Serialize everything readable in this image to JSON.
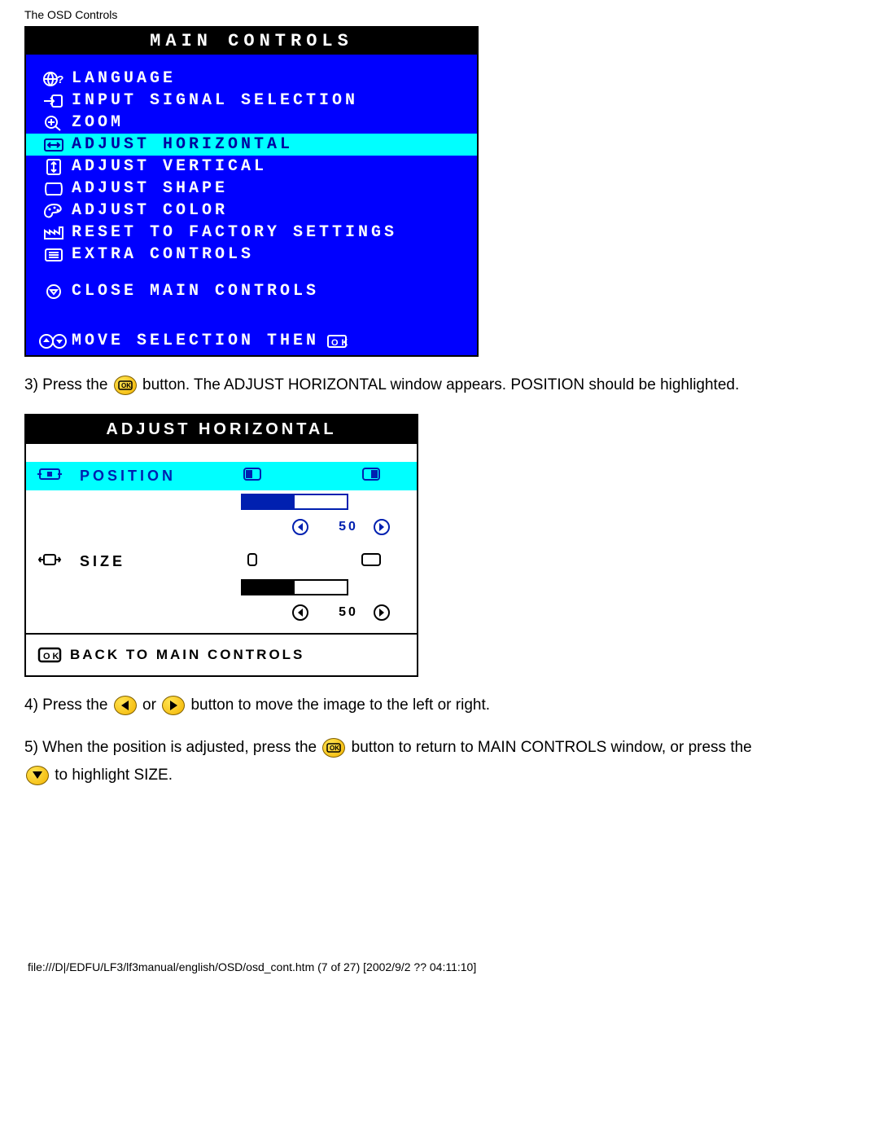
{
  "header": "The OSD Controls",
  "mainControls": {
    "title": "MAIN CONTROLS",
    "items": [
      {
        "label": "LANGUAGE",
        "highlighted": false
      },
      {
        "label": "INPUT SIGNAL SELECTION",
        "highlighted": false
      },
      {
        "label": "ZOOM",
        "highlighted": false
      },
      {
        "label": "ADJUST HORIZONTAL",
        "highlighted": true
      },
      {
        "label": "ADJUST VERTICAL",
        "highlighted": false
      },
      {
        "label": "ADJUST SHAPE",
        "highlighted": false
      },
      {
        "label": "ADJUST COLOR",
        "highlighted": false
      },
      {
        "label": "RESET TO FACTORY SETTINGS",
        "highlighted": false
      },
      {
        "label": "EXTRA CONTROLS",
        "highlighted": false
      }
    ],
    "close": "CLOSE MAIN CONTROLS",
    "footer": "MOVE SELECTION THEN"
  },
  "step3": {
    "a": "3) Press the ",
    "b": " button. The ADJUST HORIZONTAL window appears. POSITION should be highlighted."
  },
  "adjustHorizontal": {
    "title": "ADJUST HORIZONTAL",
    "position": {
      "label": "POSITION",
      "value": "50",
      "fillPercent": 50
    },
    "size": {
      "label": "SIZE",
      "value": "50",
      "fillPercent": 50
    },
    "back": "BACK TO MAIN CONTROLS"
  },
  "step4": {
    "a": "4) Press the ",
    "b": " or ",
    "c": " button to move the image to the left or right."
  },
  "step5": {
    "a": "5) When the position is adjusted, press the ",
    "b": " button to return to MAIN CONTROLS window, or press the ",
    "c": " to highlight SIZE."
  },
  "footerPath": "file:///D|/EDFU/LF3/lf3manual/english/OSD/osd_cont.htm (7 of 27) [2002/9/2 ?? 04:11:10]"
}
